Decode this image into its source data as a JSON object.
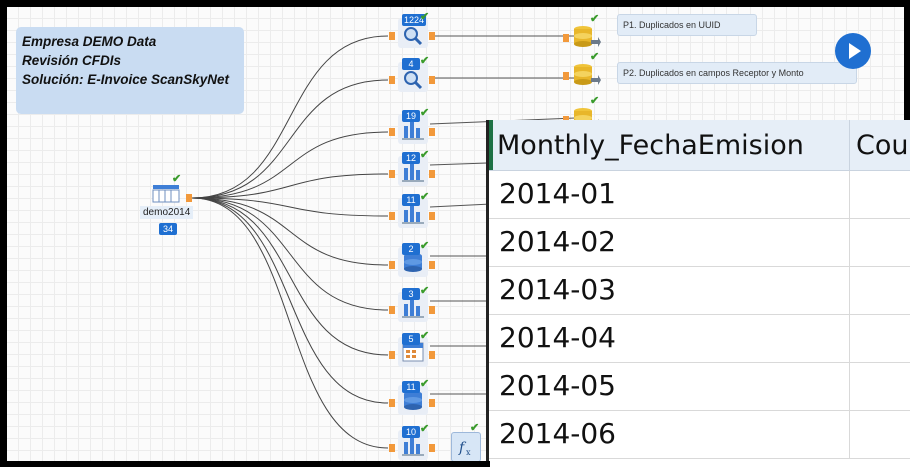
{
  "info": {
    "line1": "Empresa DEMO Data",
    "line2": "Revisión CFDIs",
    "line3": "Solución: E-Invoice ScanSkyNet"
  },
  "source": {
    "label": "demo2014",
    "count": "34",
    "icon": "table-icon"
  },
  "nodes": [
    {
      "badge": "1224",
      "icon": "search-icon"
    },
    {
      "badge": "4",
      "icon": "search-icon"
    },
    {
      "badge": "19",
      "icon": "bar-chart-icon"
    },
    {
      "badge": "12",
      "icon": "bar-chart-icon"
    },
    {
      "badge": "11",
      "icon": "bar-chart-icon"
    },
    {
      "badge": "2",
      "icon": "database-icon"
    },
    {
      "badge": "3",
      "icon": "bar-chart-icon"
    },
    {
      "badge": "5",
      "icon": "calendar-icon"
    },
    {
      "badge": "11",
      "icon": "database-icon"
    },
    {
      "badge": "10",
      "icon": "bar-chart-icon"
    }
  ],
  "outputs": [
    {
      "label": "P1. Duplicados en UUID",
      "icon": "database-export-icon"
    },
    {
      "label": "P2. Duplicados en campos Receptor y Monto",
      "icon": "database-export-icon"
    }
  ],
  "formula_icon": "function-icon",
  "play_icon": "play-icon",
  "table": {
    "headers": [
      "Monthly_FechaEmision",
      "Cou"
    ],
    "rows": [
      "2014-01",
      "2014-02",
      "2014-03",
      "2014-04",
      "2014-05",
      "2014-06"
    ]
  },
  "colors": {
    "accent": "#1f6fd1",
    "port": "#f2993b",
    "check": "#3a9b2c",
    "info_bg": "#c9dcf2"
  }
}
